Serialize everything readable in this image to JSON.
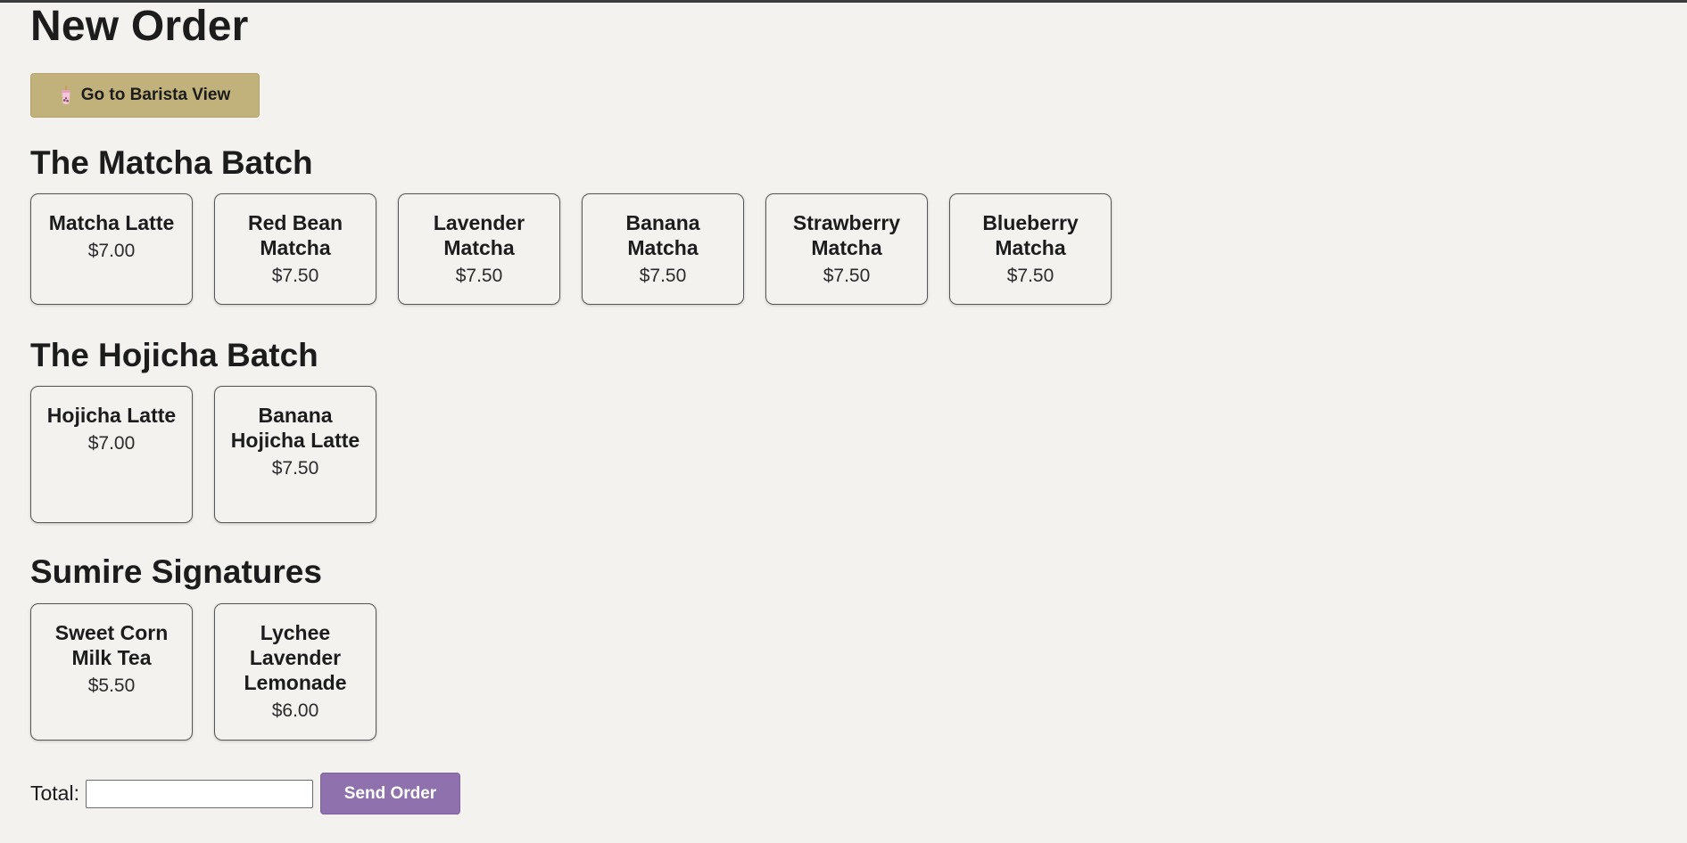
{
  "header": {
    "title": "New Order",
    "barista_button_label": "Go to Barista View",
    "barista_button_icon": "bubble-tea-cup-icon"
  },
  "sections": [
    {
      "title": "The Matcha Batch",
      "items": [
        {
          "name": "Matcha Latte",
          "price": "$7.00"
        },
        {
          "name": "Red Bean Matcha",
          "price": "$7.50"
        },
        {
          "name": "Lavender Matcha",
          "price": "$7.50"
        },
        {
          "name": "Banana Matcha",
          "price": "$7.50"
        },
        {
          "name": "Strawberry Matcha",
          "price": "$7.50"
        },
        {
          "name": "Blueberry Matcha",
          "price": "$7.50"
        }
      ]
    },
    {
      "title": "The Hojicha Batch",
      "items": [
        {
          "name": "Hojicha Latte",
          "price": "$7.00"
        },
        {
          "name": "Banana Hojicha Latte",
          "price": "$7.50"
        }
      ]
    },
    {
      "title": "Sumire Signatures",
      "items": [
        {
          "name": "Sweet Corn Milk Tea",
          "price": "$5.50"
        },
        {
          "name": "Lychee Lavender Lemonade",
          "price": "$6.00"
        }
      ]
    }
  ],
  "footer": {
    "total_label": "Total:",
    "total_value": "",
    "send_label": "Send Order"
  },
  "colors": {
    "background": "#f4f2ef",
    "barista_button": "#c1b17b",
    "send_button": "#8f72ad"
  }
}
